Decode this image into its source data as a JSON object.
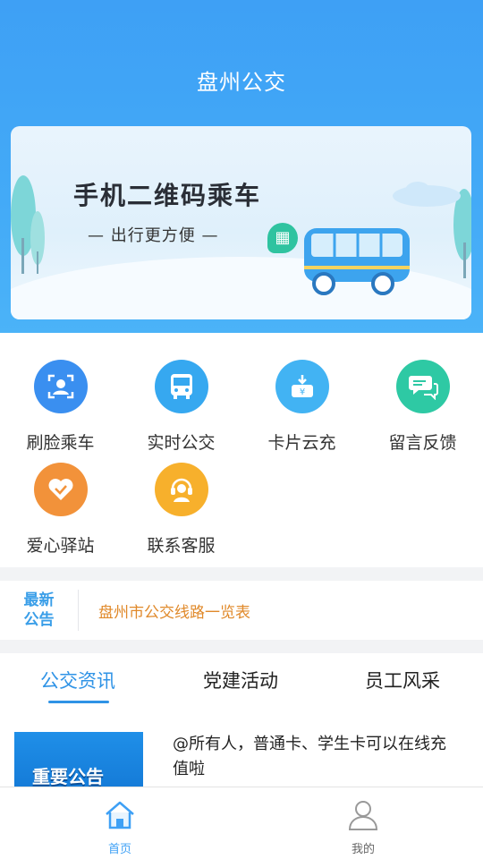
{
  "header": {
    "title": "盘州公交"
  },
  "banner": {
    "title": "手机二维码乘车",
    "subtitle": "— 出行更方便 —",
    "colors": {
      "bus": "#3da4ee",
      "qr_badge": "#2fc3a0",
      "tree": "#7dd6d8"
    }
  },
  "services": [
    {
      "label": "刷脸乘车",
      "icon": "face-scan-icon",
      "color": "#3a8ff0"
    },
    {
      "label": "实时公交",
      "icon": "bus-icon",
      "color": "#36a8f0"
    },
    {
      "label": "卡片云充",
      "icon": "card-recharge-icon",
      "color": "#42b3f3"
    },
    {
      "label": "留言反馈",
      "icon": "chat-bubble-icon",
      "color": "#2ec9a4"
    },
    {
      "label": "爱心驿站",
      "icon": "heart-icon",
      "color": "#f2923a"
    },
    {
      "label": "联系客服",
      "icon": "headset-user-icon",
      "color": "#f7b02c"
    }
  ],
  "notice": {
    "tag_line1": "最新",
    "tag_line2": "公告",
    "text": "盘州市公交线路一览表"
  },
  "tabs": [
    {
      "label": "公交资讯",
      "active": true
    },
    {
      "label": "党建活动",
      "active": false
    },
    {
      "label": "员工风采",
      "active": false
    }
  ],
  "news": [
    {
      "thumb_text": "重要公告",
      "title": "@所有人，普通卡、学生卡可以在线充值啦"
    }
  ],
  "tabbar": [
    {
      "label": "首页",
      "icon": "home-icon",
      "active": true
    },
    {
      "label": "我的",
      "icon": "user-icon",
      "active": false
    }
  ],
  "theme": {
    "primary": "#3ea0f5",
    "active_tab": "#2f93e6",
    "notice_text": "#e0892a"
  }
}
